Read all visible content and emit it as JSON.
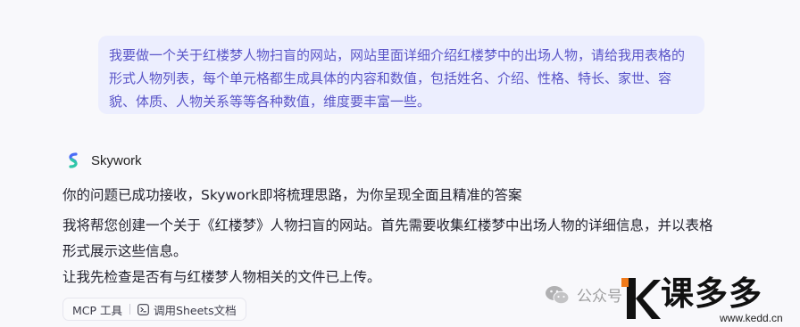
{
  "user_message": "我要做一个关于红楼梦人物扫盲的网站，网站里面详细介绍红楼梦中的出场人物，请给我用表格的形式人物列表，每个单元格都生成具体的内容和数值，包括姓名、介绍、性格、特长、家世、容貌、体质、人物关系等等各种数值，维度要丰富一些。",
  "assistant": {
    "name": "Skywork",
    "messages": [
      "你的问题已成功接收，Skywork即将梳理思路，为你呈现全面且精准的答案",
      "我将帮您创建一个关于《红楼梦》人物扫盲的网站。首先需要收集红楼梦中出场人物的详细信息，并以表格形式展示这些信息。",
      "让我先检查是否有与红楼梦人物相关的文件已上传。"
    ]
  },
  "toolbar": {
    "mcp_label": "MCP 工具",
    "sheets_label": "调用Sheets文档"
  },
  "watermark": {
    "wechat_text": "公众号",
    "logo_text": "课多多",
    "url": "www.kedd.cn"
  },
  "colors": {
    "accent": "#5a55c8",
    "bubble_bg": "#eceefe",
    "logo_orange": "#f07a1a"
  }
}
